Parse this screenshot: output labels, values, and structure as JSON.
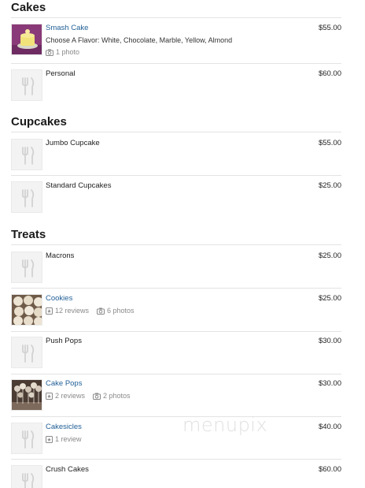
{
  "sections": [
    {
      "title": "Cakes",
      "items": [
        {
          "name": "Smash Cake",
          "linked": true,
          "description": "Choose A Flavor: White, Chocolate, Marble, Yellow, Almond",
          "photos": "1 photo",
          "reviews": null,
          "price": "$55.00",
          "thumb": "smash-cake-photo"
        },
        {
          "name": "Personal",
          "linked": false,
          "description": null,
          "photos": null,
          "reviews": null,
          "price": "$60.00",
          "thumb": "placeholder"
        }
      ]
    },
    {
      "title": "Cupcakes",
      "items": [
        {
          "name": "Jumbo Cupcake",
          "linked": false,
          "price": "$55.00",
          "thumb": "placeholder"
        },
        {
          "name": "Standard Cupcakes",
          "linked": false,
          "price": "$25.00",
          "thumb": "placeholder"
        }
      ]
    },
    {
      "title": "Treats",
      "items": [
        {
          "name": "Macrons",
          "linked": false,
          "price": "$25.00",
          "thumb": "placeholder"
        },
        {
          "name": "Cookies",
          "linked": true,
          "reviews": "12 reviews",
          "photos": "6 photos",
          "price": "$25.00",
          "thumb": "cookies-photo"
        },
        {
          "name": "Push Pops",
          "linked": false,
          "price": "$30.00",
          "thumb": "placeholder"
        },
        {
          "name": "Cake Pops",
          "linked": true,
          "reviews": "2 reviews",
          "photos": "2 photos",
          "price": "$30.00",
          "thumb": "cake-pops-photo"
        },
        {
          "name": "Cakesicles",
          "linked": true,
          "reviews": "1 review",
          "photos": null,
          "price": "$40.00",
          "thumb": "placeholder"
        },
        {
          "name": "Crush Cakes",
          "linked": false,
          "price": "$60.00",
          "thumb": "placeholder"
        }
      ]
    }
  ],
  "watermark": "menupix",
  "colors": {
    "link": "#1f5e96",
    "divider": "#e3e3e3",
    "meta": "#8a8a8a"
  }
}
